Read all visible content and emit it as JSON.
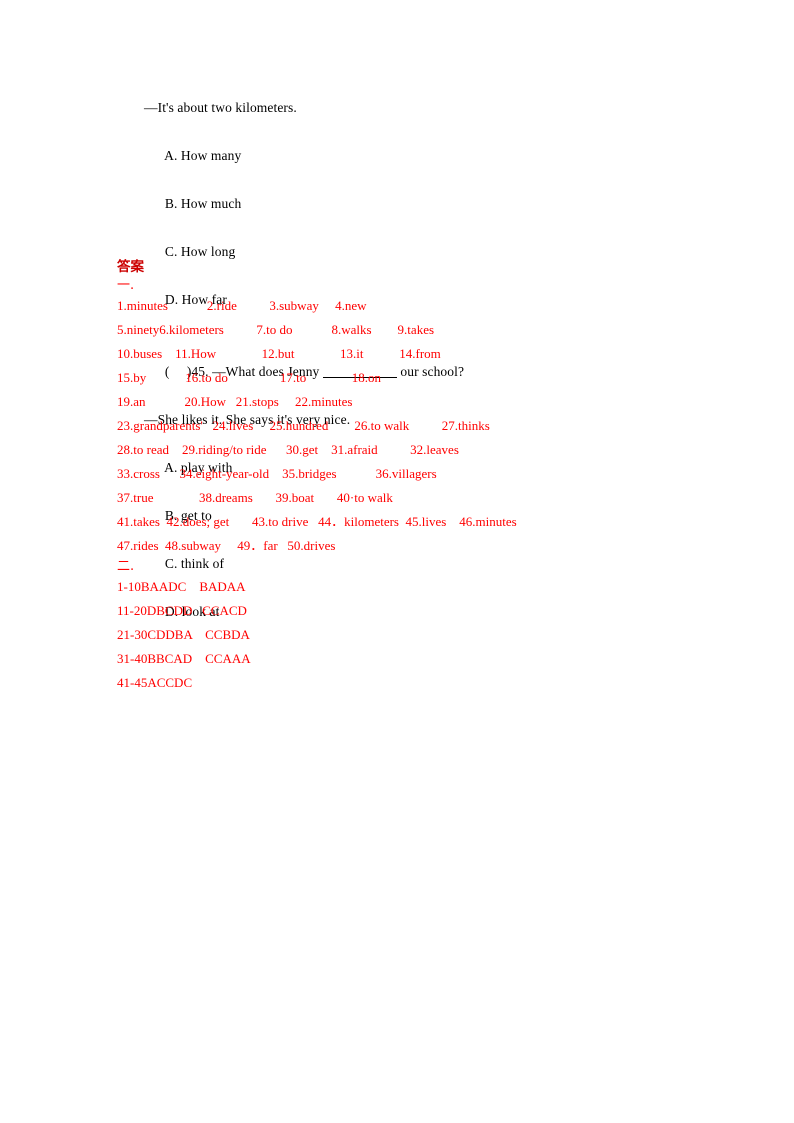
{
  "document": {
    "type": "answer-key-worksheet",
    "text_color_primary": "#000000",
    "text_color_answers": "#ff0000",
    "heading_color": "#cc0000",
    "background": "#ffffff"
  },
  "questions": {
    "answer_line_44": "—It's about two kilometers.",
    "options_44": {
      "a": "A. How many",
      "b": "B. How much",
      "c": "C. How long",
      "d": "D. How far"
    },
    "stem_45_prefix": "(     )45. —What does Jenny ",
    "stem_45_suffix": " our school?",
    "answer_line_45": "—She likes it. She says it's very nice.",
    "options_45": {
      "a": "A. play with",
      "b": "B. get to",
      "c": "C. think of",
      "d": "D. look at"
    }
  },
  "answers": {
    "heading": "答案",
    "section_one_marker": "一.",
    "section_two_marker": "二.",
    "fill_in_lines": [
      "1.minutes            2.ride          3.subway     4.new",
      "5.ninety6.kilometers          7.to do            8.walks        9.takes",
      "10.buses    11.How              12.but              13.it           14.from",
      "15.by            16.to do                17.to              18.on",
      "19.an            20.How   21.stops     22.minutes",
      "23.grandparents'   24.lives     25.hundred        26.to walk          27.thinks",
      "28.to read    29.riding/to ride      30.get    31.afraid          32.leaves",
      "33.cross      34.eight-year-old    35.bridges            36.villagers",
      "37.true              38.dreams       39.boat       40·to walk",
      "41.takes  42.does; get       43.to drive   44．kilometers  45.lives    46.minutes",
      "47.rides  48.subway     49．far   50.drives"
    ],
    "multiple_choice_lines": [
      "1-10BAADC    BADAA",
      "11-20DBCDD   CCACD",
      "21-30CDDBA    CCBDA",
      "31-40BBCAD    CCAAA",
      "41-45ACCDC"
    ]
  }
}
